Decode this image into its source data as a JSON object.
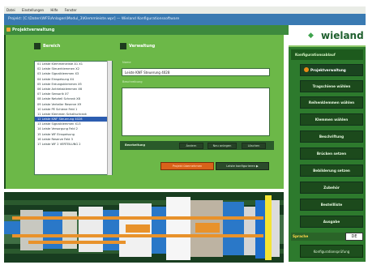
{
  "menu": [
    "Datei",
    "Einstellungen",
    "Hilfe",
    "Fenster"
  ],
  "window_title": "Projekt: [C:\\Daten\\WFS\\Anlagen\\Modul_3\\Klemmleiste.wpr] — Wieland Konfigurationssoftware",
  "header": {
    "title": "Projektverwaltung"
  },
  "left_panel": {
    "title": "Bereich",
    "items": [
      "01 Leiste Klemmenleiste A1 X1",
      "02 Leiste Steuerklemmen X2",
      "03 Leiste Signalklemmen X3",
      "04 Leiste Einspeisung X4",
      "05 Leiste Erdungsklemmen X5",
      "06 Leiste Antriebsklemmen X6",
      "07 Leiste Sensorik X7",
      "08 Leiste Netzteil Schrank X8",
      "09 Leiste Verteiler Reserve X9",
      "10 Leiste PE Schiene Feld 1",
      "11 Leiste Klemmen Schaltschrank",
      "12 Leiste KWF Steuerung 4028",
      "13 Leiste Signalklemmen X13",
      "14 Leiste Versorgung Feld 2",
      "15 Leiste WF Einspeisung",
      "16 Leiste Reserve Feld 3",
      "17 Leiste WF 2 VERTEILUNG 2"
    ],
    "selected_index": 11
  },
  "right_panel": {
    "title": "Verwaltung",
    "name_label": "Name",
    "name_value": "Leiste KWF Steuerung 4028",
    "desc_label": "Beschreibung",
    "desc_value": ""
  },
  "action_bar": {
    "label": "Bearbeitung",
    "buttons": [
      "Ändern",
      "Neu anlegen",
      "Löschen"
    ]
  },
  "buttons": {
    "orange": "Projekt übernehmen",
    "dark": "Leiste konfigurieren ▶"
  },
  "sidebar": {
    "logo": "wieland",
    "title": "Konfigurationsablauf",
    "items": [
      "Projektverwaltung",
      "Tragschiene wählen",
      "Reihenklemmen wählen",
      "Klemmen wählen",
      "Beschriftung",
      "Brücken setzen",
      "Bebilderung setzen",
      "Zubehör",
      "Bestellliste",
      "Ausgabe"
    ],
    "active_index": 0,
    "lang_label": "Sprache",
    "lang_value": "DE",
    "config_button": "Konfigurationsprüfung"
  },
  "colors": {
    "main_green": "#6cb848",
    "dark_green": "#1c4a1c",
    "accent_orange": "#d9621a",
    "title_blue": "#3a7ab2"
  }
}
